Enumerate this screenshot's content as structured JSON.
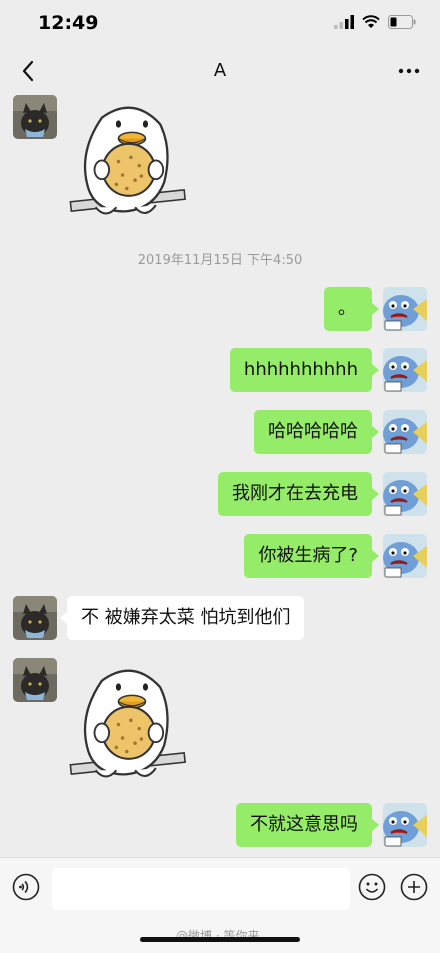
{
  "status_bar": {
    "time": "12:49"
  },
  "nav": {
    "title": "A"
  },
  "timestamp": "2019年11月15日 下午4:50",
  "messages": [
    {
      "from": "them",
      "kind": "sticker",
      "sticker": "duck-holding-cookie-sticker"
    },
    {
      "from": "me",
      "kind": "text",
      "text": "。"
    },
    {
      "from": "me",
      "kind": "text",
      "text": "hhhhhhhhhh"
    },
    {
      "from": "me",
      "kind": "text",
      "text": "哈哈哈哈哈"
    },
    {
      "from": "me",
      "kind": "text",
      "text": "我刚才在去充电"
    },
    {
      "from": "me",
      "kind": "text",
      "text": "你被生病了?"
    },
    {
      "from": "them",
      "kind": "text",
      "text": "不 被嫌弃太菜 怕坑到他们"
    },
    {
      "from": "them",
      "kind": "sticker",
      "sticker": "duck-holding-cookie-sticker"
    },
    {
      "from": "me",
      "kind": "text",
      "text": "不就这意思吗"
    }
  ],
  "input_bar": {
    "placeholder": ""
  },
  "watermark": "@微博 · 等你来",
  "colors": {
    "my_bubble": "#95ec69",
    "their_bubble": "#ffffff",
    "background": "#ededed"
  }
}
